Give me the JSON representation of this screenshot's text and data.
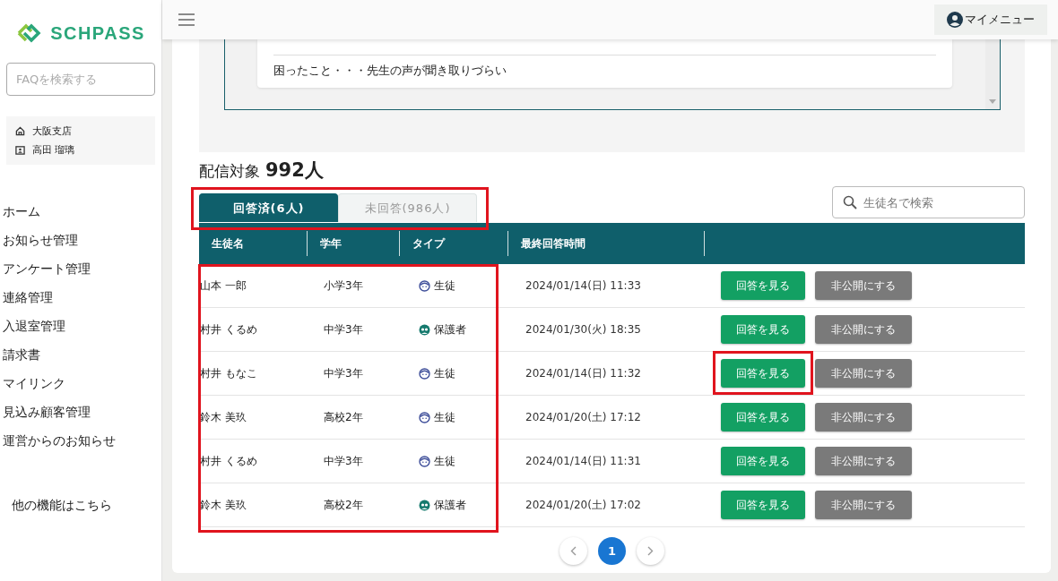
{
  "sidebar": {
    "logo": "SCHPASS",
    "search": {
      "placeholder": "FAQを検索する"
    },
    "user": {
      "branch": "大阪支店",
      "name": "高田 瑠璃"
    },
    "items": [
      {
        "label": "ホーム"
      },
      {
        "label": "お知らせ管理"
      },
      {
        "label": "アンケート管理"
      },
      {
        "label": "連絡管理"
      },
      {
        "label": "入退室管理"
      },
      {
        "label": "請求書"
      },
      {
        "label": "マイリンク"
      },
      {
        "label": "見込み顧客管理"
      },
      {
        "label": "運営からのお知らせ"
      }
    ],
    "more": "他の機能はこちら"
  },
  "header": {
    "menu_button": "マイメニュー"
  },
  "answer_preview": {
    "line": "困ったこと・・・先生の声が聞き取りづらい"
  },
  "recipients": {
    "label": "配信対象",
    "count": "992人"
  },
  "tabs": [
    {
      "label": "回答済(6人)",
      "selected": true
    },
    {
      "label": "未回答(986人)",
      "selected": false
    }
  ],
  "tabs_highlighted": true,
  "search": {
    "placeholder": "生徒名で検索"
  },
  "table": {
    "columns": [
      "生徒名",
      "学年",
      "タイプ",
      "最終回答時間"
    ],
    "rows_highlighted": true,
    "rows": [
      {
        "name": "山本 一郎",
        "grade": "小学3年",
        "type": {
          "kind": "student",
          "label": "生徒"
        },
        "time": "2024/01/14(日) 11:33",
        "view": {
          "label": "回答を見る",
          "highlighted": false
        },
        "hide": "非公開にする"
      },
      {
        "name": "村井 くるめ",
        "grade": "中学3年",
        "type": {
          "kind": "guardian",
          "label": "保護者"
        },
        "time": "2024/01/30(火) 18:35",
        "view": {
          "label": "回答を見る",
          "highlighted": false
        },
        "hide": "非公開にする"
      },
      {
        "name": "村井 もなこ",
        "grade": "中学3年",
        "type": {
          "kind": "student",
          "label": "生徒"
        },
        "time": "2024/01/14(日) 11:32",
        "view": {
          "label": "回答を見る",
          "highlighted": true
        },
        "hide": "非公開にする"
      },
      {
        "name": "鈴木 美玖",
        "grade": "高校2年",
        "type": {
          "kind": "student",
          "label": "生徒"
        },
        "time": "2024/01/20(土) 17:12",
        "view": {
          "label": "回答を見る",
          "highlighted": false
        },
        "hide": "非公開にする"
      },
      {
        "name": "村井 くるめ",
        "grade": "中学3年",
        "type": {
          "kind": "student",
          "label": "生徒"
        },
        "time": "2024/01/14(日) 11:31",
        "view": {
          "label": "回答を見る",
          "highlighted": false
        },
        "hide": "非公開にする"
      },
      {
        "name": "鈴木 美玖",
        "grade": "高校2年",
        "type": {
          "kind": "guardian",
          "label": "保護者"
        },
        "time": "2024/01/20(土) 17:02",
        "view": {
          "label": "回答を見る",
          "highlighted": false
        },
        "hide": "非公開にする"
      }
    ]
  },
  "pagination": {
    "pages": [
      {
        "label": "1",
        "selected": true
      }
    ]
  }
}
